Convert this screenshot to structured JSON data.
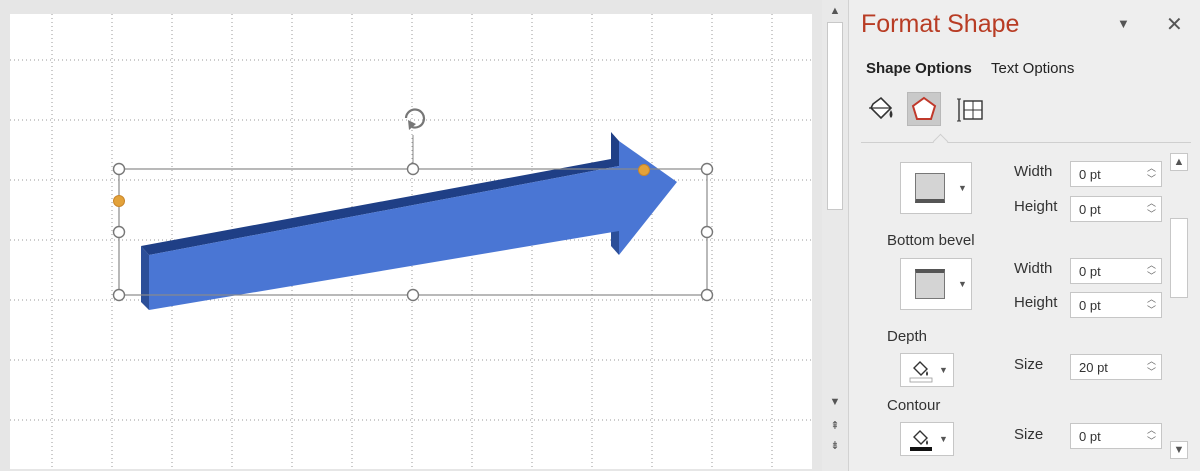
{
  "pane": {
    "title": "Format Shape",
    "dropdown_icon": "chevron-down-icon",
    "close_icon": "close-icon",
    "tabs": [
      {
        "label": "Shape Options",
        "selected": true
      },
      {
        "label": "Text Options",
        "selected": false
      }
    ],
    "categories": [
      {
        "name": "fill-line-icon"
      },
      {
        "name": "effects-icon",
        "selected": true
      },
      {
        "name": "size-properties-icon"
      }
    ],
    "top_bevel": {
      "width_label": "Width",
      "width_value": "0 pt",
      "height_label": "Height",
      "height_value": "0 pt"
    },
    "bottom_bevel": {
      "label": "Bottom bevel",
      "width_label": "Width",
      "width_value": "0 pt",
      "height_label": "Height",
      "height_value": "0 pt"
    },
    "depth": {
      "label": "Depth",
      "size_label": "Size",
      "size_value": "20 pt"
    },
    "contour": {
      "label": "Contour",
      "size_label": "Size",
      "size_value": "0 pt"
    }
  },
  "canvas": {
    "shape": "3d-arrow",
    "fill_color": "#4a76d4",
    "side_color": "#2c4f99",
    "top_color": "#1f3f86",
    "handle_color": "#e3a23a"
  },
  "colors": {
    "accent_title": "#b83c24"
  }
}
